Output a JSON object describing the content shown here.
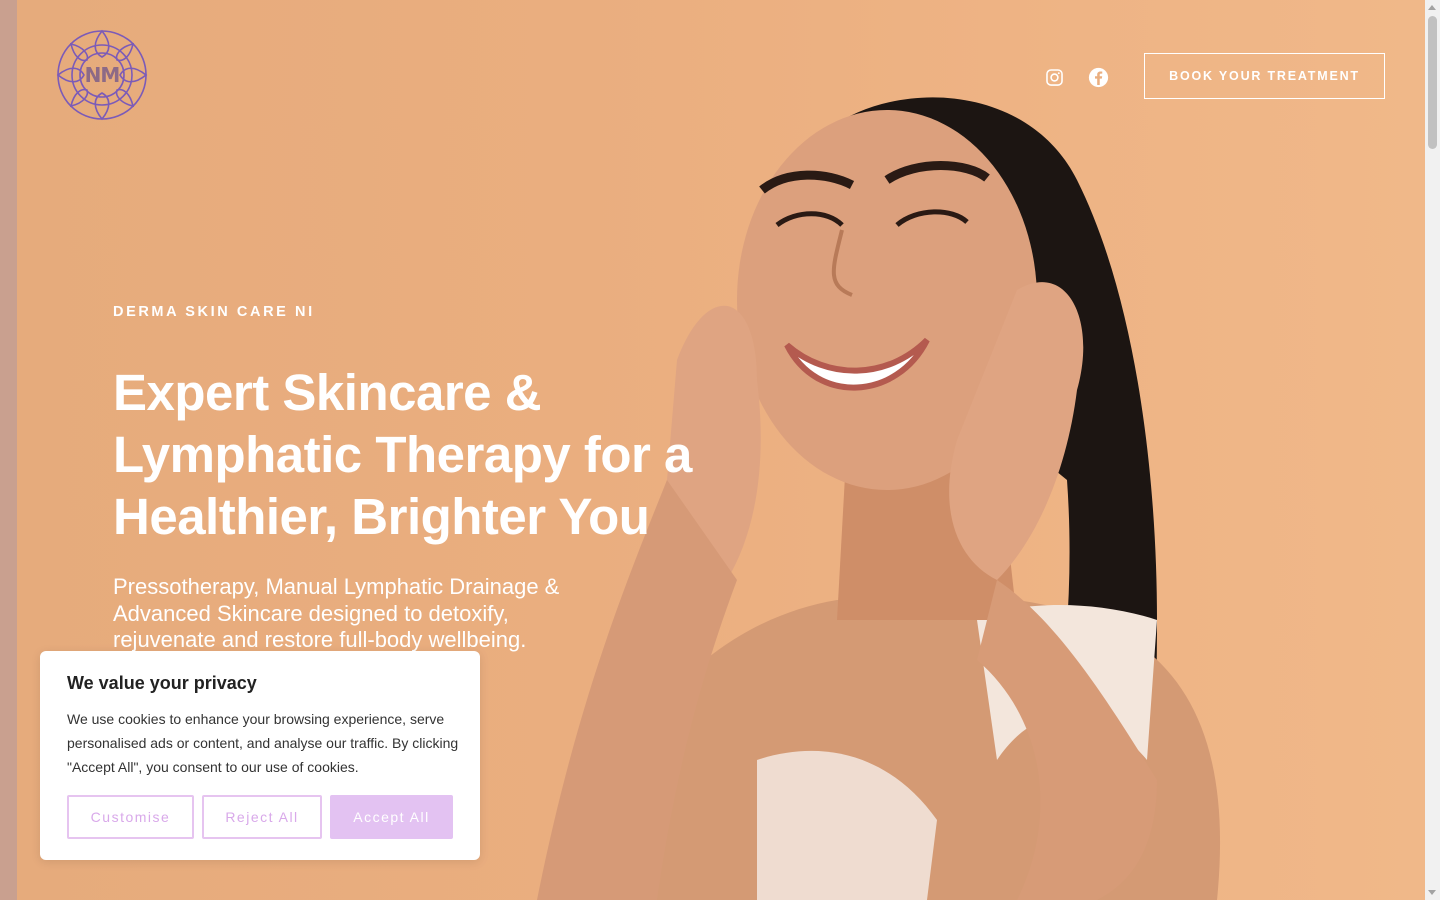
{
  "brand": {
    "logo_text": "NM",
    "eyebrow": "DERMA SKIN CARE NI"
  },
  "header": {
    "social": [
      {
        "name": "instagram",
        "icon": "instagram-icon"
      },
      {
        "name": "facebook",
        "icon": "facebook-icon"
      }
    ],
    "book_button": "BOOK YOUR TREATMENT"
  },
  "hero": {
    "headline": "Expert Skincare & Lymphatic Therapy for a Healthier, Brighter You",
    "subheadline": "Pressotherapy, Manual Lymphatic Drainage & Advanced Skincare designed to detoxify, rejuvenate and restore full-body wellbeing."
  },
  "cookie_banner": {
    "title": "We value your privacy",
    "text": "We use cookies to enhance your browsing experience, serve personalised ads or content, and analyse our traffic. By clicking \"Accept All\", you consent to our use of cookies.",
    "buttons": {
      "customise": "Customise",
      "reject": "Reject All",
      "accept": "Accept All"
    }
  },
  "colors": {
    "hero_bg": "#eaae7f",
    "accent_purple": "#8b5fbf",
    "cookie_button": "#e3c2f2"
  }
}
